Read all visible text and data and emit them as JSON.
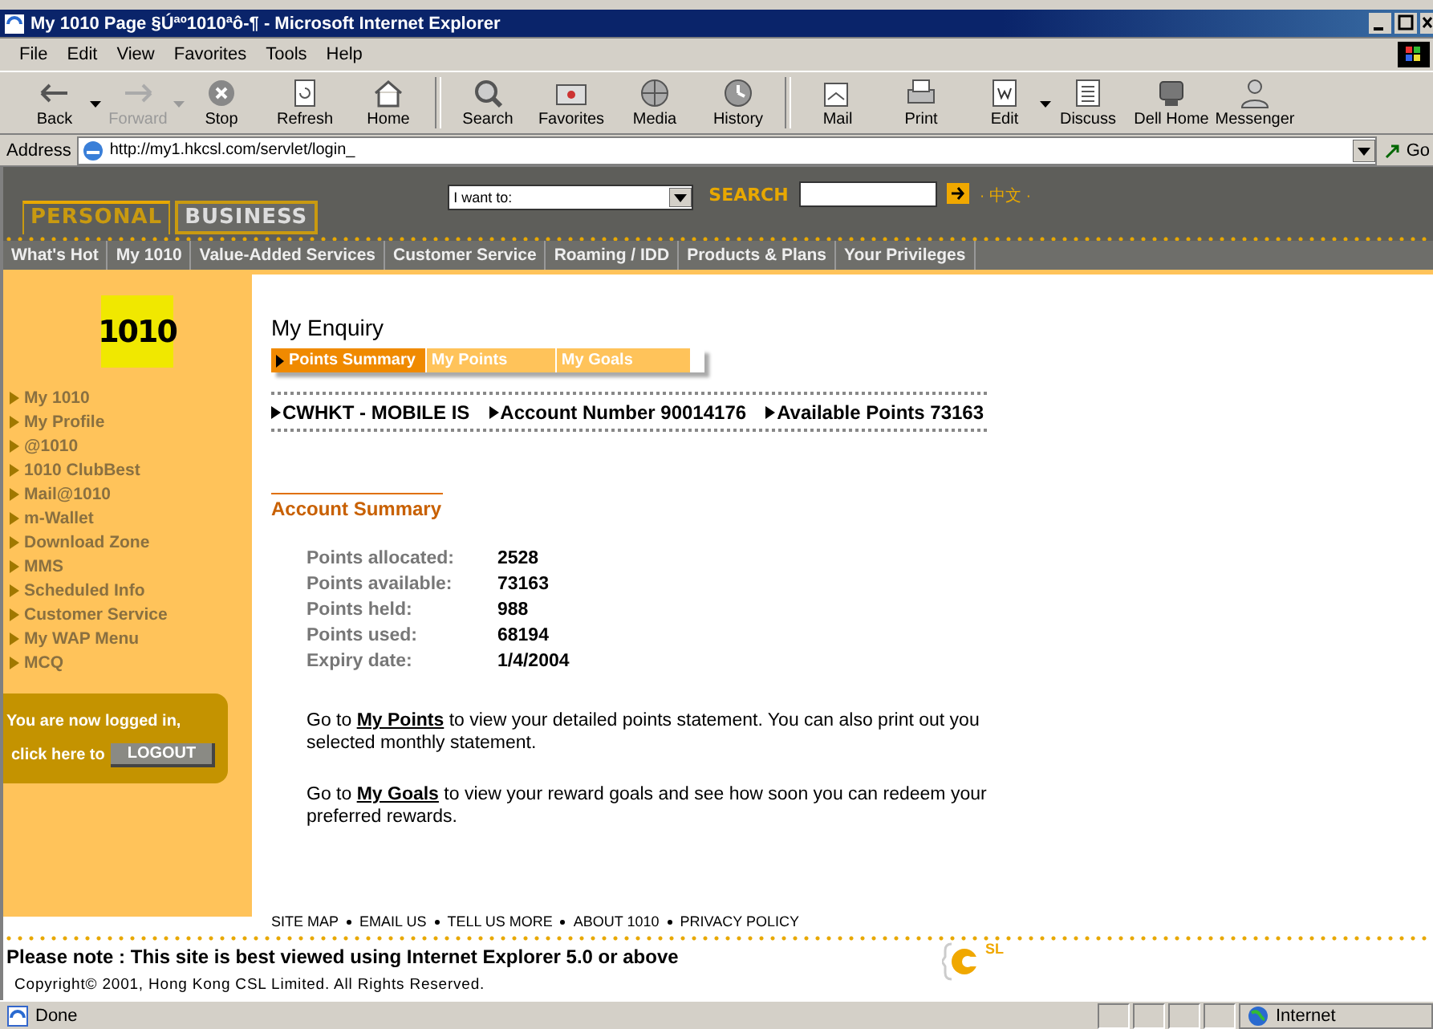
{
  "window": {
    "title": "My 1010 Page §Úªº1010ªô-¶ - Microsoft Internet Explorer"
  },
  "menu": [
    "File",
    "Edit",
    "View",
    "Favorites",
    "Tools",
    "Help"
  ],
  "toolbar": [
    {
      "label": "Back",
      "disabled": false,
      "dropdown": true
    },
    {
      "label": "Forward",
      "disabled": true,
      "dropdown": true
    },
    {
      "label": "Stop",
      "disabled": false,
      "dropdown": false
    },
    {
      "label": "Refresh",
      "disabled": false,
      "dropdown": false
    },
    {
      "label": "Home",
      "disabled": false,
      "dropdown": false
    },
    {
      "label": "Search",
      "disabled": false,
      "dropdown": false
    },
    {
      "label": "Favorites",
      "disabled": false,
      "dropdown": false
    },
    {
      "label": "Media",
      "disabled": false,
      "dropdown": false
    },
    {
      "label": "History",
      "disabled": false,
      "dropdown": false
    },
    {
      "label": "Mail",
      "disabled": false,
      "dropdown": false
    },
    {
      "label": "Print",
      "disabled": false,
      "dropdown": false
    },
    {
      "label": "Edit",
      "disabled": false,
      "dropdown": true
    },
    {
      "label": "Discuss",
      "disabled": false,
      "dropdown": false
    },
    {
      "label": "Dell Home",
      "disabled": false,
      "dropdown": false
    },
    {
      "label": "Messenger",
      "disabled": false,
      "dropdown": false
    }
  ],
  "address": {
    "label": "Address",
    "url": "http://my1.hkcsl.com/servlet/login_",
    "go": "Go"
  },
  "site_header": {
    "segments": [
      {
        "label": "PERSONAL",
        "selected": true
      },
      {
        "label": "BUSINESS",
        "selected": false
      }
    ],
    "dropdown": "I want to:",
    "search_label": "SEARCH",
    "language": "· 中文 ·"
  },
  "nav": [
    "What's Hot",
    "My 1010",
    "Value-Added Services",
    "Customer Service",
    "Roaming / IDD",
    "Products & Plans",
    "Your Privileges"
  ],
  "sidebar": {
    "logo": "1010",
    "items": [
      "My 1010",
      "My Profile",
      "@1010",
      "1010 ClubBest",
      "Mail@1010",
      "m-Wallet",
      "Download Zone",
      "MMS",
      "Scheduled Info",
      "Customer Service",
      "My WAP Menu",
      "MCQ"
    ],
    "login_text": "You are now logged in,",
    "logout_prompt": "click here to",
    "logout_button": "LOGOUT"
  },
  "content": {
    "title": "My Enquiry",
    "tabs": [
      {
        "label": "Points Summary",
        "selected": true
      },
      {
        "label": "My Points",
        "selected": false
      },
      {
        "label": "My Goals",
        "selected": false
      }
    ],
    "info": [
      "CWHKT - MOBILE IS",
      "Account Number 90014176",
      "Available Points 73163"
    ],
    "section_title": "Account Summary",
    "summary": [
      {
        "label": "Points allocated:",
        "value": "2528"
      },
      {
        "label": "Points available:",
        "value": "73163"
      },
      {
        "label": "Points held:",
        "value": "988"
      },
      {
        "label": "Points used:",
        "value": "68194"
      },
      {
        "label": "Expiry date:",
        "value": "1/4/2004"
      }
    ],
    "paragraphs": [
      {
        "before": "Go to ",
        "link": "My Points",
        "after": " to view your detailed points statement. You can also print out you selected monthly statement."
      },
      {
        "before": "Go to ",
        "link": "My Goals",
        "after": " to view your reward goals and see how soon you can redeem your preferred rewards."
      }
    ]
  },
  "footer": {
    "links": [
      "SITE MAP",
      "EMAIL US",
      "TELL US MORE",
      "ABOUT 1010",
      "PRIVACY POLICY"
    ],
    "note": "Please note : This site is best viewed using Internet Explorer 5.0 or above",
    "copyright": "Copyright© 2001, Hong Kong CSL Limited. All Rights Reserved.",
    "logo": "SL"
  },
  "status_bar": {
    "text": "Done",
    "zone": "Internet"
  }
}
